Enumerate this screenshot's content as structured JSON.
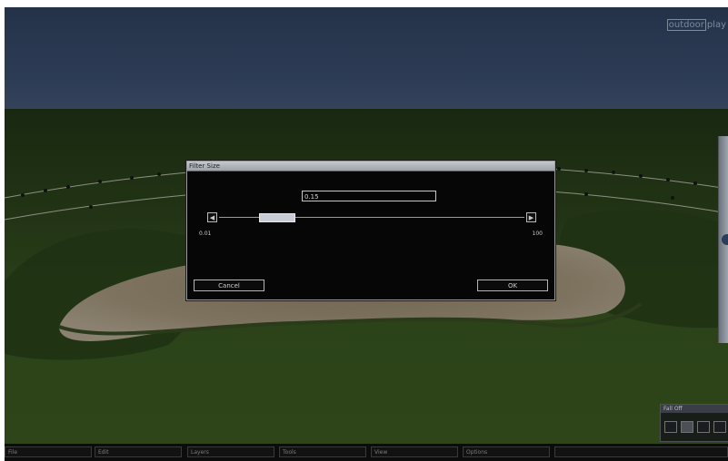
{
  "app": {
    "watermark_boxed": "outdoor",
    "watermark_rest": "play"
  },
  "dialog": {
    "title": "Filter Size",
    "value": "0.15",
    "slider": {
      "min_label": "0.01",
      "max_label": "100",
      "position_fraction": 0.15
    },
    "cancel_label": "Cancel",
    "ok_label": "OK"
  },
  "falloff_panel": {
    "title": "Fall Off",
    "selected_option": 2
  },
  "menubar": {
    "items": [
      "File",
      "Edit",
      "Layers",
      "Tools",
      "View",
      "Options",
      ""
    ]
  },
  "colors": {
    "sky": "#2d3c55",
    "grass": "#2c4319",
    "sand": "#7a6f5c",
    "dialog_bg": "#070606",
    "accent_thumb": "#c7ccd6"
  }
}
